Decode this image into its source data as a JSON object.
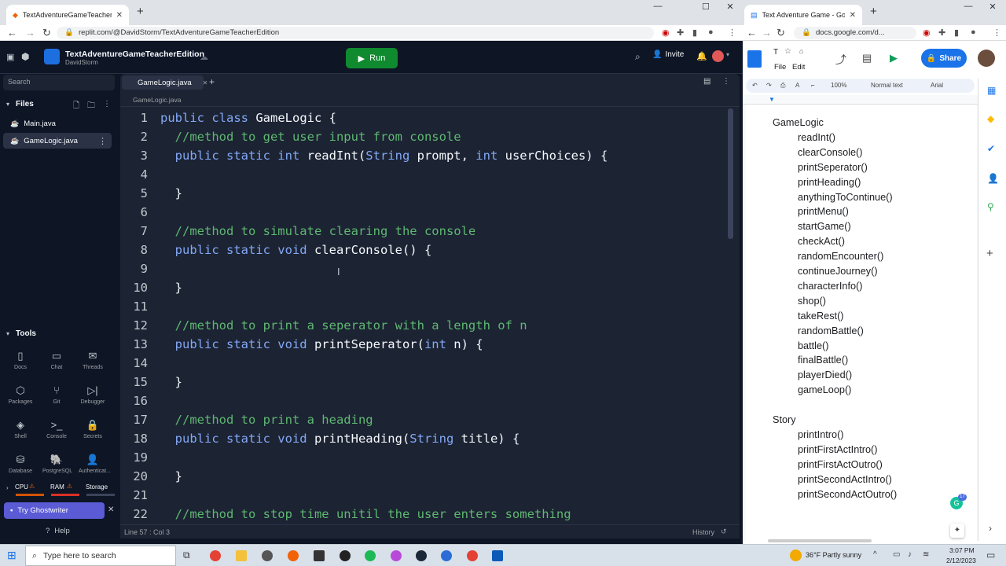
{
  "left_browser": {
    "tab_title": "TextAdventureGameTeacherEdition",
    "url": "replit.com/@DavidStorm/TextAdventureGameTeacherEdition"
  },
  "replit": {
    "repl_name": "TextAdventureGameTeacherEdition",
    "owner": "DavidStorm",
    "run_label": "Run",
    "invite_label": "Invite",
    "search_placeholder": "Search",
    "files_label": "Files",
    "files": [
      "Main.java",
      "GameLogic.java"
    ],
    "tools_label": "Tools",
    "tools": [
      {
        "label": "Docs",
        "icon": "docs-icon"
      },
      {
        "label": "Chat",
        "icon": "chat-icon"
      },
      {
        "label": "Threads",
        "icon": "threads-icon"
      },
      {
        "label": "Packages",
        "icon": "packages-icon"
      },
      {
        "label": "Git",
        "icon": "git-icon"
      },
      {
        "label": "Debugger",
        "icon": "debugger-icon"
      },
      {
        "label": "Shell",
        "icon": "shell-icon"
      },
      {
        "label": "Console",
        "icon": "console-icon"
      },
      {
        "label": "Secrets",
        "icon": "secrets-icon"
      },
      {
        "label": "Database",
        "icon": "database-icon"
      },
      {
        "label": "PostgreSQL",
        "icon": "postgresql-icon"
      },
      {
        "label": "Authenticat...",
        "icon": "authentication-icon"
      }
    ],
    "resources": {
      "cpu": "CPU",
      "ram": "RAM",
      "storage": "Storage"
    },
    "ghostwriter_label": "Try Ghostwriter",
    "help_label": "Help",
    "editor_tab": "GameLogic.java",
    "breadcrumb": "GameLogic.java",
    "status": "Line 57 : Col 3",
    "history": "History",
    "code_lines": [
      {
        "n": "1",
        "parts": [
          [
            "k",
            "public class "
          ],
          [
            "t",
            "GameLogic {"
          ]
        ]
      },
      {
        "n": "2",
        "parts": [
          [
            "c",
            "  //method to get user input from console"
          ]
        ]
      },
      {
        "n": "3",
        "parts": [
          [
            "k",
            "  public static int "
          ],
          [
            "t",
            "readInt("
          ],
          [
            "ty",
            "String"
          ],
          [
            "t",
            " prompt, "
          ],
          [
            "k",
            "int"
          ],
          [
            "t",
            " userChoices) {"
          ]
        ]
      },
      {
        "n": "4",
        "parts": []
      },
      {
        "n": "5",
        "parts": [
          [
            "t",
            "  }"
          ]
        ]
      },
      {
        "n": "6",
        "parts": []
      },
      {
        "n": "7",
        "parts": [
          [
            "c",
            "  //method to simulate clearing the console"
          ]
        ]
      },
      {
        "n": "8",
        "parts": [
          [
            "k",
            "  public static void "
          ],
          [
            "t",
            "clearConsole() {"
          ]
        ]
      },
      {
        "n": "9",
        "parts": []
      },
      {
        "n": "10",
        "parts": [
          [
            "t",
            "  }"
          ]
        ]
      },
      {
        "n": "11",
        "parts": []
      },
      {
        "n": "12",
        "parts": [
          [
            "c",
            "  //method to print a seperator with a length of n"
          ]
        ]
      },
      {
        "n": "13",
        "parts": [
          [
            "k",
            "  public static void "
          ],
          [
            "t",
            "printSeperator("
          ],
          [
            "k",
            "int"
          ],
          [
            "t",
            " n) {"
          ]
        ]
      },
      {
        "n": "14",
        "parts": []
      },
      {
        "n": "15",
        "parts": [
          [
            "t",
            "  }"
          ]
        ]
      },
      {
        "n": "16",
        "parts": []
      },
      {
        "n": "17",
        "parts": [
          [
            "c",
            "  //method to print a heading"
          ]
        ]
      },
      {
        "n": "18",
        "parts": [
          [
            "k",
            "  public static void "
          ],
          [
            "t",
            "printHeading("
          ],
          [
            "ty",
            "String"
          ],
          [
            "t",
            " title) {"
          ]
        ]
      },
      {
        "n": "19",
        "parts": []
      },
      {
        "n": "20",
        "parts": [
          [
            "t",
            "  }"
          ]
        ]
      },
      {
        "n": "21",
        "parts": []
      },
      {
        "n": "22",
        "parts": [
          [
            "c",
            "  //method to stop time unitil the user enters something"
          ]
        ]
      }
    ]
  },
  "right_browser": {
    "tab_title": "Text Adventure Game - Google D",
    "url": "docs.google.com/d...",
    "menu_file": "File",
    "menu_edit": "Edit",
    "share_label": "Share",
    "zoom": "100%",
    "style": "Normal text",
    "font": "Arial"
  },
  "doc": {
    "section1_title": "GameLogic",
    "section1_items": [
      "readInt()",
      "clearConsole()",
      "printSeperator()",
      "printHeading()",
      "anythingToContinue()",
      "printMenu()",
      "startGame()",
      "checkAct()",
      "randomEncounter()",
      "continueJourney()",
      "characterInfo()",
      "shop()",
      "takeRest()",
      "randomBattle()",
      "battle()",
      "finalBattle()",
      "playerDied()",
      "gameLoop()"
    ],
    "section2_title": "Story",
    "section2_items": [
      "printIntro()",
      "printFirstActIntro()",
      "printFirstActOutro()",
      "printSecondActIntro()",
      "printSecondActOutro()"
    ],
    "grammarly_count": "17"
  },
  "taskbar": {
    "search_placeholder": "Type here to search",
    "weather": "36°F  Partly sunny",
    "time": "3:07 PM",
    "date": "2/12/2023"
  },
  "colors": {
    "run_green": "#0f8a2e",
    "replit_bg": "#0e1525",
    "editor_bg": "#1c2333",
    "ghostwriter": "#5b5bd6",
    "docs_blue": "#1a73e8"
  }
}
